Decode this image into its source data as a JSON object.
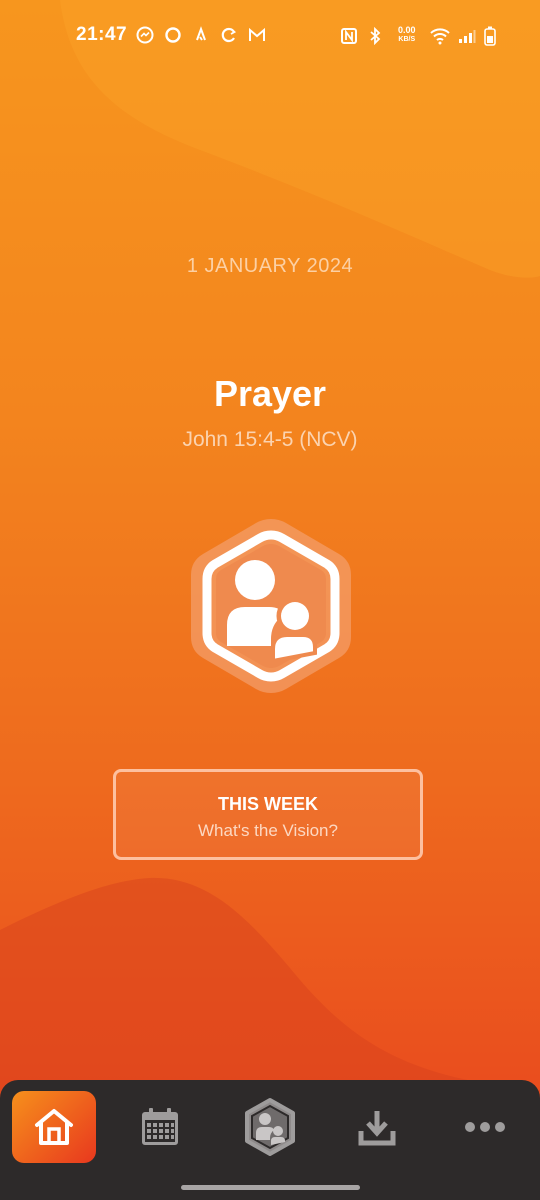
{
  "status_bar": {
    "time": "21:47",
    "net_speed_value": "0.00",
    "net_speed_unit": "KB/S",
    "left_icons": [
      "messenger-icon",
      "circle-app-icon",
      "strava-icon",
      "sync-icon",
      "gmail-icon"
    ],
    "right_icons": [
      "nfc-icon",
      "bluetooth-icon",
      "wifi-icon",
      "signal-icon",
      "battery-icon"
    ]
  },
  "main": {
    "date": "1 JANUARY 2024",
    "title": "Prayer",
    "reference": "John 15:4-5 (NCV)",
    "hero_icon": "parent-child-hexagon-icon"
  },
  "week_card": {
    "title": "THIS WEEK",
    "subtitle": "What's the Vision?"
  },
  "tab_bar": {
    "tabs": [
      {
        "icon": "home-icon",
        "active": true
      },
      {
        "icon": "calendar-icon",
        "active": false
      },
      {
        "icon": "parent-child-hexagon-icon",
        "active": false
      },
      {
        "icon": "download-icon",
        "active": false
      },
      {
        "icon": "more-icon",
        "active": false
      }
    ]
  },
  "colors": {
    "gradient_top": "#F7961E",
    "gradient_bottom": "#E8431E",
    "tab_bar_bg": "#2D2A2A",
    "active_tab_start": "#F6901C",
    "active_tab_end": "#E8381E"
  }
}
